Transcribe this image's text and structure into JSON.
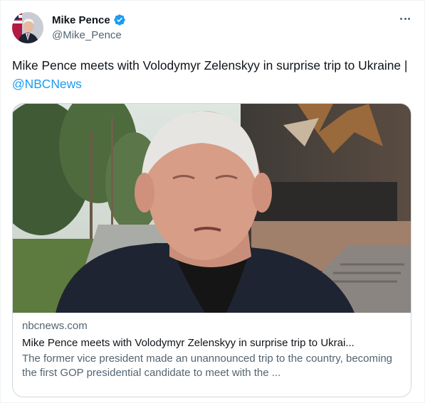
{
  "author": {
    "display_name": "Mike Pence",
    "handle": "@Mike_Pence",
    "verified": true,
    "avatar_icon": "avatar-portrait-with-flag"
  },
  "tweet": {
    "text_main": "Mike Pence meets with Volodymyr Zelenskyy in surprise trip to Ukraine | ",
    "mention": "@NBCNews"
  },
  "card": {
    "domain": "nbcnews.com",
    "title": "Mike Pence meets with Volodymyr Zelenskyy in surprise trip to Ukrai...",
    "description": "The former vice president made an unannounced trip to the country, becoming the first GOP presidential candidate to meet with the ..."
  },
  "colors": {
    "link": "#1d9bf0",
    "verified": "#1d9bf0",
    "secondary_text": "#536471",
    "border": "#cfd9de"
  },
  "icons": {
    "verified": "verified-badge-icon",
    "more": "more-options-icon"
  }
}
